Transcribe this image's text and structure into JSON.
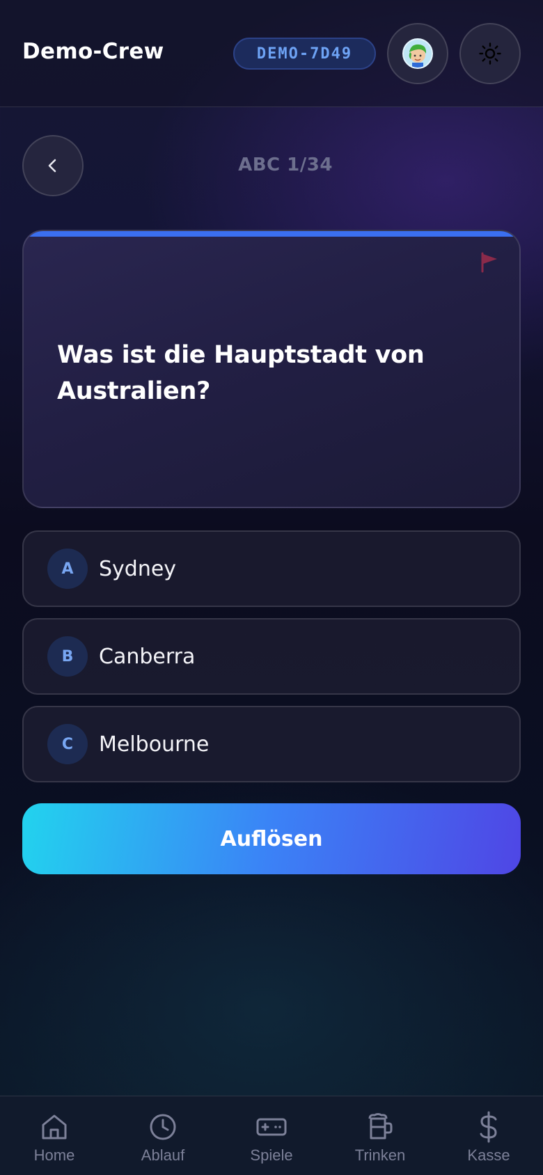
{
  "header": {
    "crew_name": "Demo-Crew",
    "room_code": "DEMO-7D49",
    "avatar_icon": "avatar-icon",
    "theme_icon": "sun-icon"
  },
  "quiz": {
    "progress": "ABC 1/34",
    "question": "Was ist die Hauptstadt von Australien?",
    "answers": [
      {
        "letter": "A",
        "text": "Sydney"
      },
      {
        "letter": "B",
        "text": "Canberra"
      },
      {
        "letter": "C",
        "text": "Melbourne"
      }
    ],
    "reveal_label": "Auflösen"
  },
  "nav": {
    "items": [
      {
        "label": "Home",
        "icon": "home-icon"
      },
      {
        "label": "Ablauf",
        "icon": "clock-icon"
      },
      {
        "label": "Spiele",
        "icon": "gamepad-icon"
      },
      {
        "label": "Trinken",
        "icon": "beer-icon"
      },
      {
        "label": "Kasse",
        "icon": "dollar-icon"
      }
    ]
  },
  "colors": {
    "accent_blue": "#3b6ff0",
    "gradient_start": "#22d3ee",
    "gradient_end": "#4f46e5",
    "flag": "#8a2a4a"
  }
}
